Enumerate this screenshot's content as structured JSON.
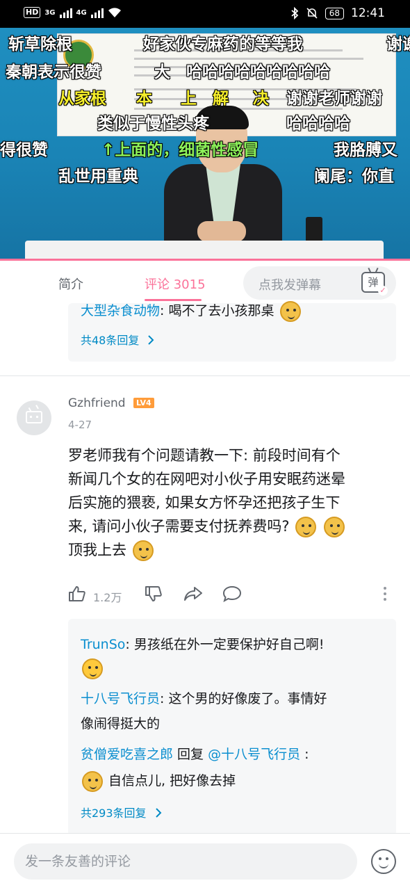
{
  "status_bar": {
    "hd": "HD",
    "sim1": "3G",
    "sim2": "4G",
    "battery": "68",
    "time": "12:41"
  },
  "video": {
    "danmaku": [
      "斩草除根",
      "好家伙专麻药的等等我",
      "谢谢",
      "秦朝表示很赞",
      "大",
      "哈哈哈哈哈哈哈哈哈",
      "从家根",
      "本",
      "上",
      "解",
      "决",
      "谢谢老师谢谢",
      "类似于慢性头疼",
      "哈哈哈哈",
      "得很赞",
      "↑上面的，细菌性感冒",
      "我胳膊又",
      "乱世用重典",
      "阑尾：你直"
    ]
  },
  "tabs": {
    "intro": "简介",
    "comments": "评论 3015",
    "danmaku_placeholder": "点我发弹幕",
    "danmaku_icon": "弹"
  },
  "reply_box_1": {
    "user": "大型杂食动物",
    "text": ": 喝不了去小孩那桌",
    "emoji": "doge",
    "more": "共48条回复"
  },
  "comment": {
    "user": "Gzhfriend",
    "level": "LV4",
    "date": "4-27",
    "lines": [
      "罗老师我有个问题请教一下: 前段时间有个",
      "新闻几个女的在网吧对小伙子用安眠药迷晕",
      "后实施的猥亵, 如果女方怀孕还把孩子生下",
      "来, 请问小伙子需要支付抚养费吗?",
      "顶我上去"
    ],
    "likes": "1.2万"
  },
  "reply_box_2": {
    "r1_user": "TrunSo",
    "r1_text": ": 男孩纸在外一定要保护好自己啊!",
    "r2_user": "十八号飞行员",
    "r2_text_a": ": 这个男的好像废了。事情好",
    "r2_text_b": "像闹得挺大的",
    "r3_user": "贫僧爱吃喜之郎",
    "r3_mid": " 回复 ",
    "r3_target": "@十八号飞行员",
    "r3_colon": " :",
    "r3_text": "自信点儿, 把好像去掉",
    "more": "共293条回复"
  },
  "bottom_bar": {
    "placeholder": "发一条友善的评论"
  },
  "colors": {
    "accent": "#fb7299",
    "link": "#008ac5",
    "level": "#ff9c3a"
  }
}
